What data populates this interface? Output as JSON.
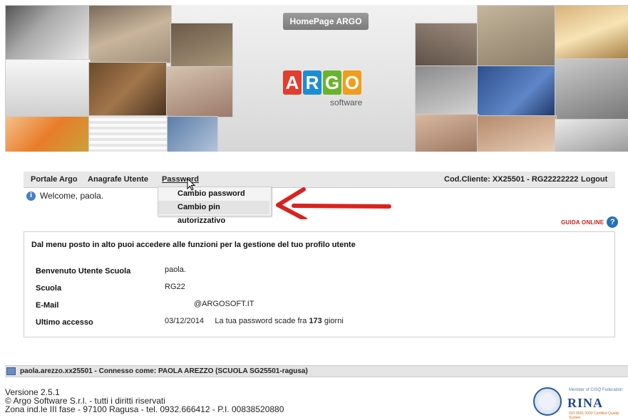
{
  "banner": {
    "title": "HomePage ARGO",
    "logo_letters": [
      "A",
      "R",
      "G",
      "O"
    ],
    "logo_colors": [
      "#e23d2e",
      "#1b8ed3",
      "#6ab42d",
      "#f19d1c"
    ],
    "logo_sub": "software"
  },
  "menu": {
    "portale": "Portale Argo",
    "anagrafe": "Anagrafe Utente",
    "password": "Password",
    "cod_cliente": "Cod.Cliente: XX25501 - RG22222222",
    "logout": "Logout"
  },
  "dropdown": {
    "items": [
      "Cambio password",
      "Cambio pin autorizzativo"
    ]
  },
  "welcome": "Welcome, paola.",
  "guida": "GUIDA ONLINE",
  "content": {
    "intro": "Dal menu posto in alto puoi accedere alle funzioni per la gestione del tuo profilo utente",
    "rows": [
      {
        "label": "Benvenuto Utente Scuola",
        "value": "paola."
      },
      {
        "label": "Scuola",
        "value": "RG22"
      },
      {
        "label": "E-Mail",
        "value": "@ARGOSOFT.IT"
      },
      {
        "label": "Ultimo accesso",
        "value": "03/12/2014"
      }
    ],
    "pwd_expiry_prefix": "La tua password scade fra",
    "pwd_expiry_days": "173",
    "pwd_expiry_suffix": "giorni"
  },
  "status": "paola.arezzo.xx25501 - Connesso come: PAOLA AREZZO (SCUOLA SG25501-ragusa)",
  "footer": {
    "version": "Versione 2.5.1",
    "copyright": "© Argo Software S.r.l. - tutti i diritti riservati",
    "address": "Zona ind.le III fase - 97100 Ragusa - tel. 0932.666412 - P.I. 00838520880"
  },
  "rina": {
    "small": "Member of CISQ Federation",
    "name": "RINA",
    "iso": "ISO 9001:2000 Certified Quality System"
  },
  "colors": {
    "arrow": "#d8231f",
    "guida": "#c0211e"
  }
}
